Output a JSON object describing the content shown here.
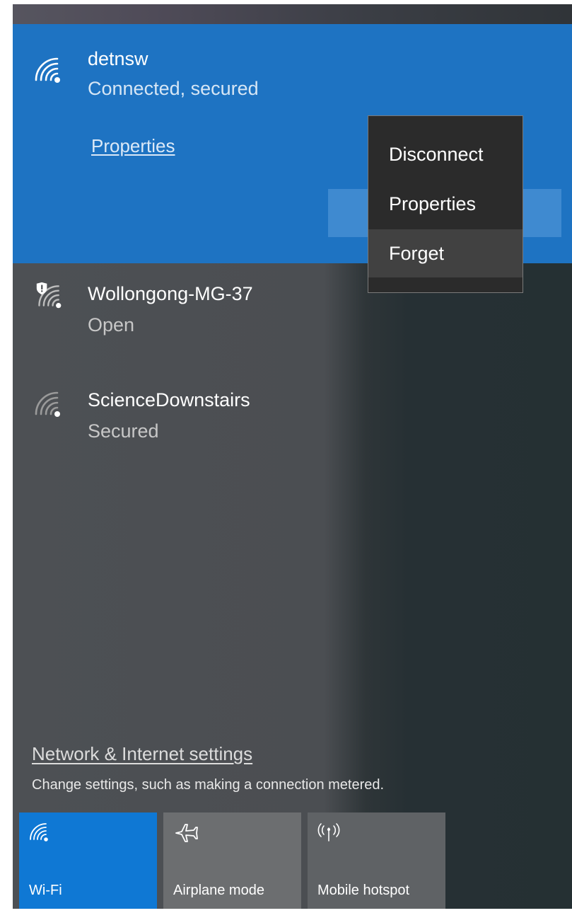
{
  "connected_network": {
    "name": "detnsw",
    "status": "Connected, secured",
    "properties_link": "Properties"
  },
  "context_menu": {
    "items": [
      {
        "label": "Disconnect"
      },
      {
        "label": "Properties"
      },
      {
        "label": "Forget"
      }
    ]
  },
  "networks": [
    {
      "name": "Wollongong-MG-37",
      "status": "Open",
      "icon": "wifi-warning-icon"
    },
    {
      "name": "ScienceDownstairs",
      "status": "Secured",
      "icon": "wifi-icon"
    }
  ],
  "settings": {
    "link": "Network & Internet settings",
    "description": "Change settings, such as making a connection metered."
  },
  "quick_actions": [
    {
      "label": "Wi-Fi",
      "icon": "wifi-icon",
      "active": true
    },
    {
      "label": "Airplane mode",
      "icon": "airplane-icon",
      "active": false
    },
    {
      "label": "Mobile hotspot",
      "icon": "hotspot-icon",
      "active": false
    }
  ],
  "colors": {
    "accent": "#0f78d4",
    "connected_bg": "#1e73c2",
    "panel_bg": "#4b4e52",
    "menu_bg": "#2b2b2b"
  }
}
